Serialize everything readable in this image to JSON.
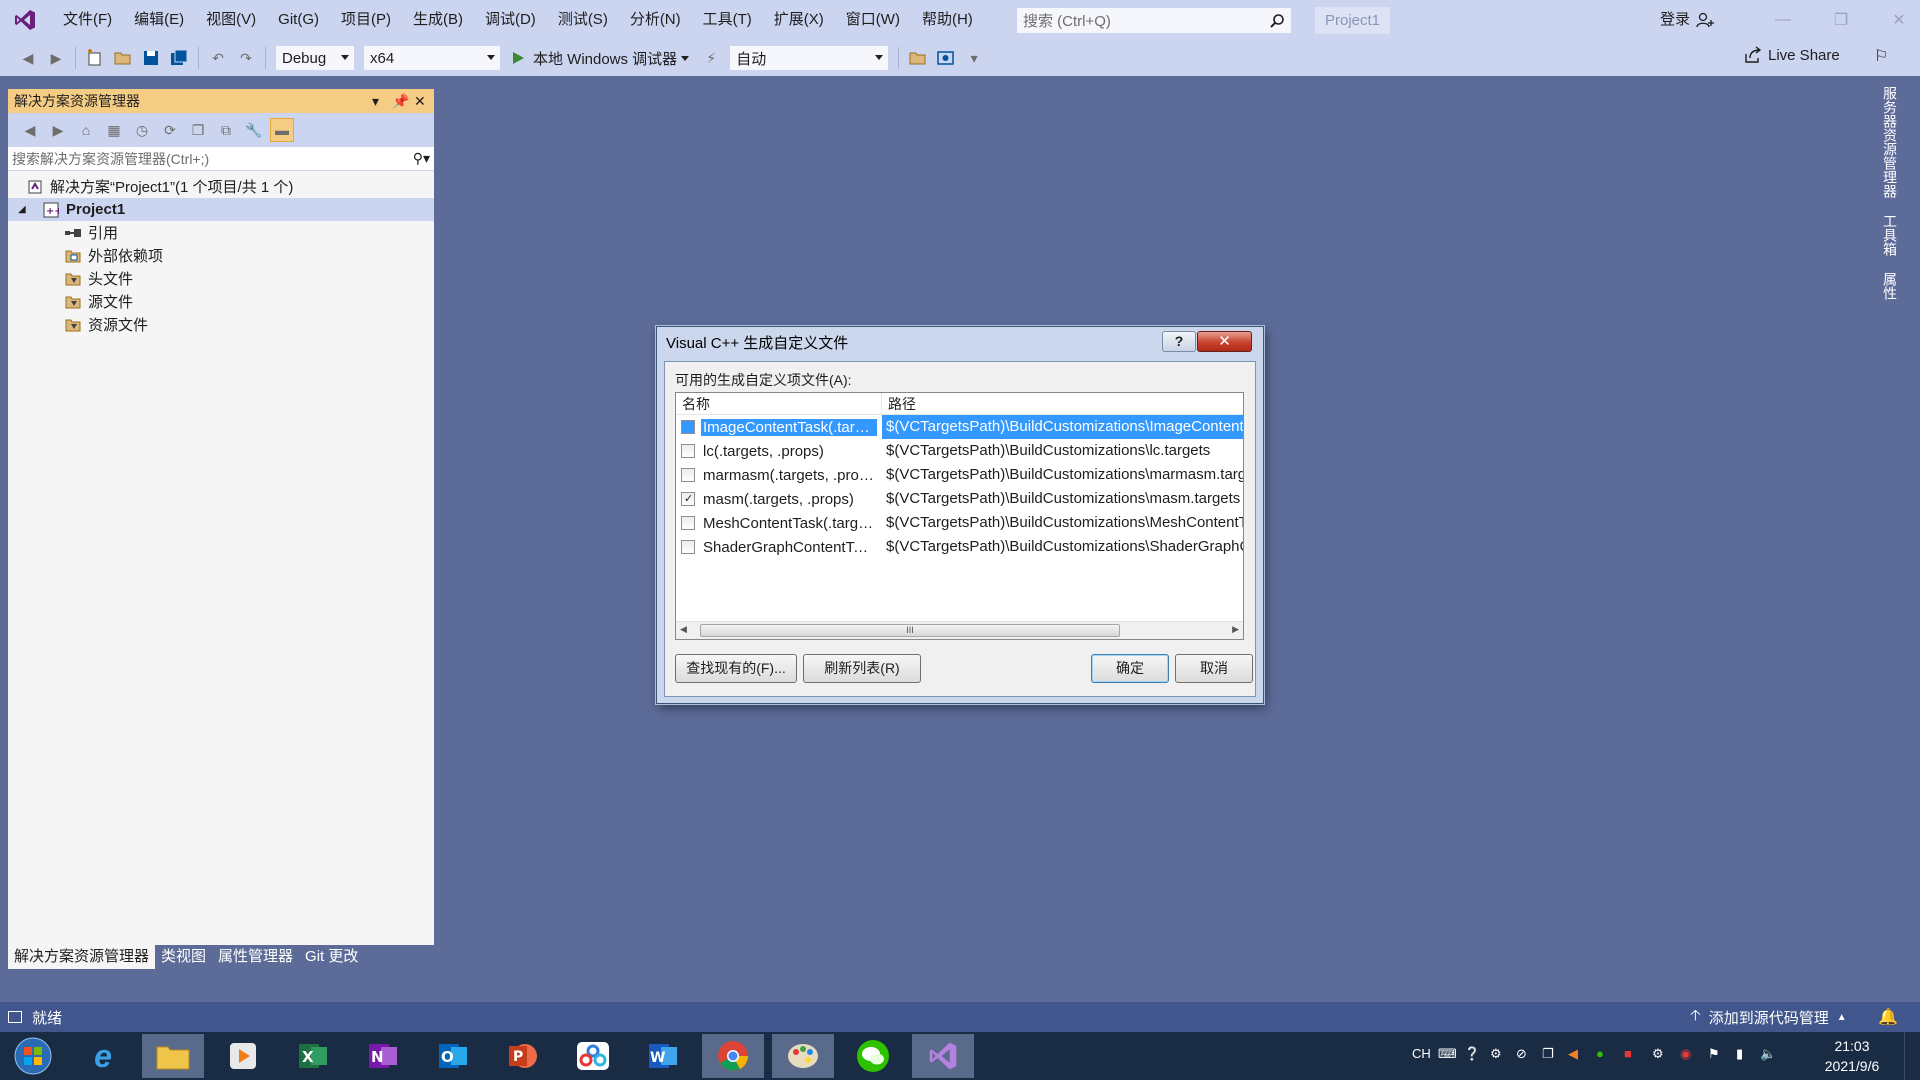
{
  "menu": {
    "items": [
      "文件(F)",
      "编辑(E)",
      "视图(V)",
      "Git(G)",
      "项目(P)",
      "生成(B)",
      "调试(D)",
      "测试(S)",
      "分析(N)",
      "工具(T)",
      "扩展(X)",
      "窗口(W)",
      "帮助(H)"
    ],
    "search_placeholder": "搜索 (Ctrl+Q)",
    "project_name": "Project1",
    "login": "登录"
  },
  "toolbar": {
    "config": "Debug",
    "platform": "x64",
    "debugger": "本地 Windows 调试器",
    "auto": "自动",
    "live_share": "Live Share"
  },
  "explorer": {
    "title": "解决方案资源管理器",
    "search_placeholder": "搜索解决方案资源管理器(Ctrl+;)",
    "solution": "解决方案“Project1”(1 个项目/共 1 个)",
    "project": "Project1",
    "nodes": [
      "引用",
      "外部依赖项",
      "头文件",
      "源文件",
      "资源文件"
    ],
    "tabs": [
      "解决方案资源管理器",
      "类视图",
      "属性管理器",
      "Git 更改"
    ]
  },
  "side_tabs": [
    "服务器资源管理器",
    "工具箱",
    "属性"
  ],
  "status": {
    "text": "就绪",
    "source_control": "添加到源代码管理"
  },
  "dialog": {
    "title": "Visual C++ 生成自定义文件",
    "help": "?",
    "close": "✕",
    "label": "可用的生成自定义项文件(A):",
    "columns": {
      "name": "名称",
      "path": "路径"
    },
    "rows": [
      {
        "name": "ImageContentTask(.targets, .props)",
        "path": "$(VCTargetsPath)\\BuildCustomizations\\ImageContentTask.targets",
        "checked": false,
        "selected": true
      },
      {
        "name": "lc(.targets, .props)",
        "path": "$(VCTargetsPath)\\BuildCustomizations\\lc.targets",
        "checked": false,
        "selected": false
      },
      {
        "name": "marmasm(.targets, .props)",
        "path": "$(VCTargetsPath)\\BuildCustomizations\\marmasm.targets",
        "checked": false,
        "selected": false
      },
      {
        "name": "masm(.targets, .props)",
        "path": "$(VCTargetsPath)\\BuildCustomizations\\masm.targets",
        "checked": true,
        "selected": false
      },
      {
        "name": "MeshContentTask(.targets, .props)",
        "path": "$(VCTargetsPath)\\BuildCustomizations\\MeshContentTask.targets",
        "checked": false,
        "selected": false
      },
      {
        "name": "ShaderGraphContentTask(.targets, .props)",
        "path": "$(VCTargetsPath)\\BuildCustomizations\\ShaderGraphContentTask.targets",
        "checked": false,
        "selected": false
      }
    ],
    "scroll_grip": "III",
    "buttons": {
      "find": "查找现有的(F)...",
      "refresh": "刷新列表(R)",
      "ok": "确定",
      "cancel": "取消"
    }
  },
  "taskbar": {
    "apps": [
      "start-orb",
      "internet-explorer",
      "file-explorer",
      "media-player",
      "excel",
      "onenote",
      "outlook",
      "powerpoint",
      "baidu-netdisk",
      "word",
      "chrome",
      "paint",
      "wechat",
      "visual-studio"
    ],
    "lang": "CH",
    "time": "21:03",
    "date": "2021/9/6"
  }
}
